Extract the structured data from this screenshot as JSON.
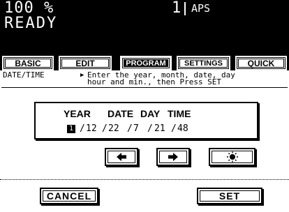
{
  "status": {
    "zoom": "100 %",
    "copies": "1",
    "paper": "APS",
    "message": "READY"
  },
  "tabs": [
    {
      "label": "BASIC",
      "active": false
    },
    {
      "label": "EDIT",
      "active": false
    },
    {
      "label": "PROGRAM",
      "active": true
    },
    {
      "label": "SETTINGS",
      "active": false
    },
    {
      "label": "QUICK",
      "active": false
    }
  ],
  "screen": {
    "title": "DATE/TIME",
    "instruction_line1": "Enter the year, month, date, day",
    "instruction_line2": "hour and min., then Press SET"
  },
  "date_time": {
    "headers": [
      "YEAR",
      "DATE",
      "DAY",
      "TIME"
    ],
    "year": "1",
    "month": "12",
    "date": "22",
    "day": "7",
    "hour": "21",
    "minute": "48"
  },
  "icons": {
    "left": "arrow-left-icon",
    "right": "arrow-right-icon",
    "third": "brightness-icon"
  },
  "buttons": {
    "cancel": "CANCEL",
    "set": "SET"
  }
}
